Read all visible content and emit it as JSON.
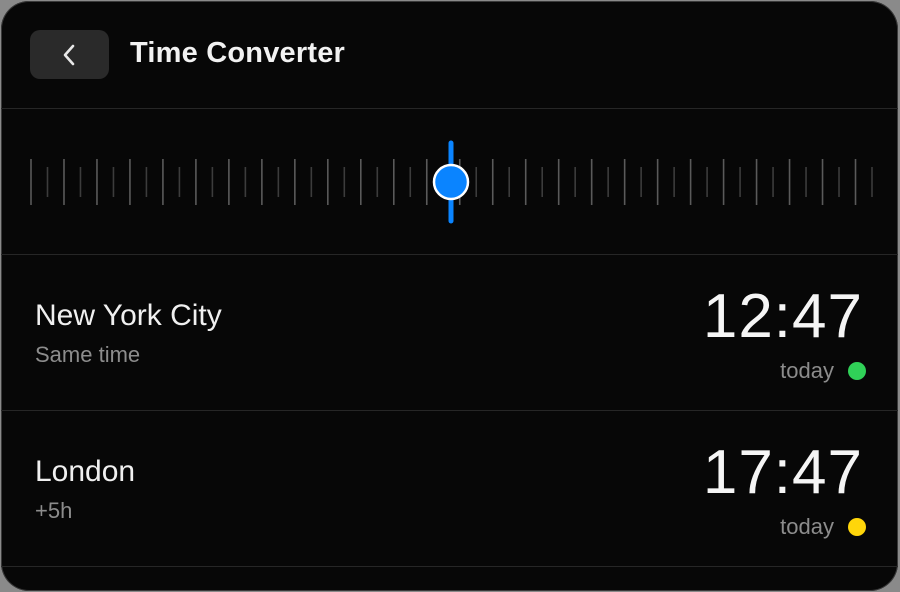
{
  "header": {
    "back_icon": "chevron-left-icon",
    "title": "Time Converter"
  },
  "slider": {
    "accent_color": "#0a84ff",
    "tick_count": 52
  },
  "rows": [
    {
      "city": "New York City",
      "offset": "Same time",
      "time": "12:47",
      "day": "today",
      "dot_color": "#30d158"
    },
    {
      "city": "London",
      "offset": "+5h",
      "time": "17:47",
      "day": "today",
      "dot_color": "#ffd60a"
    }
  ]
}
